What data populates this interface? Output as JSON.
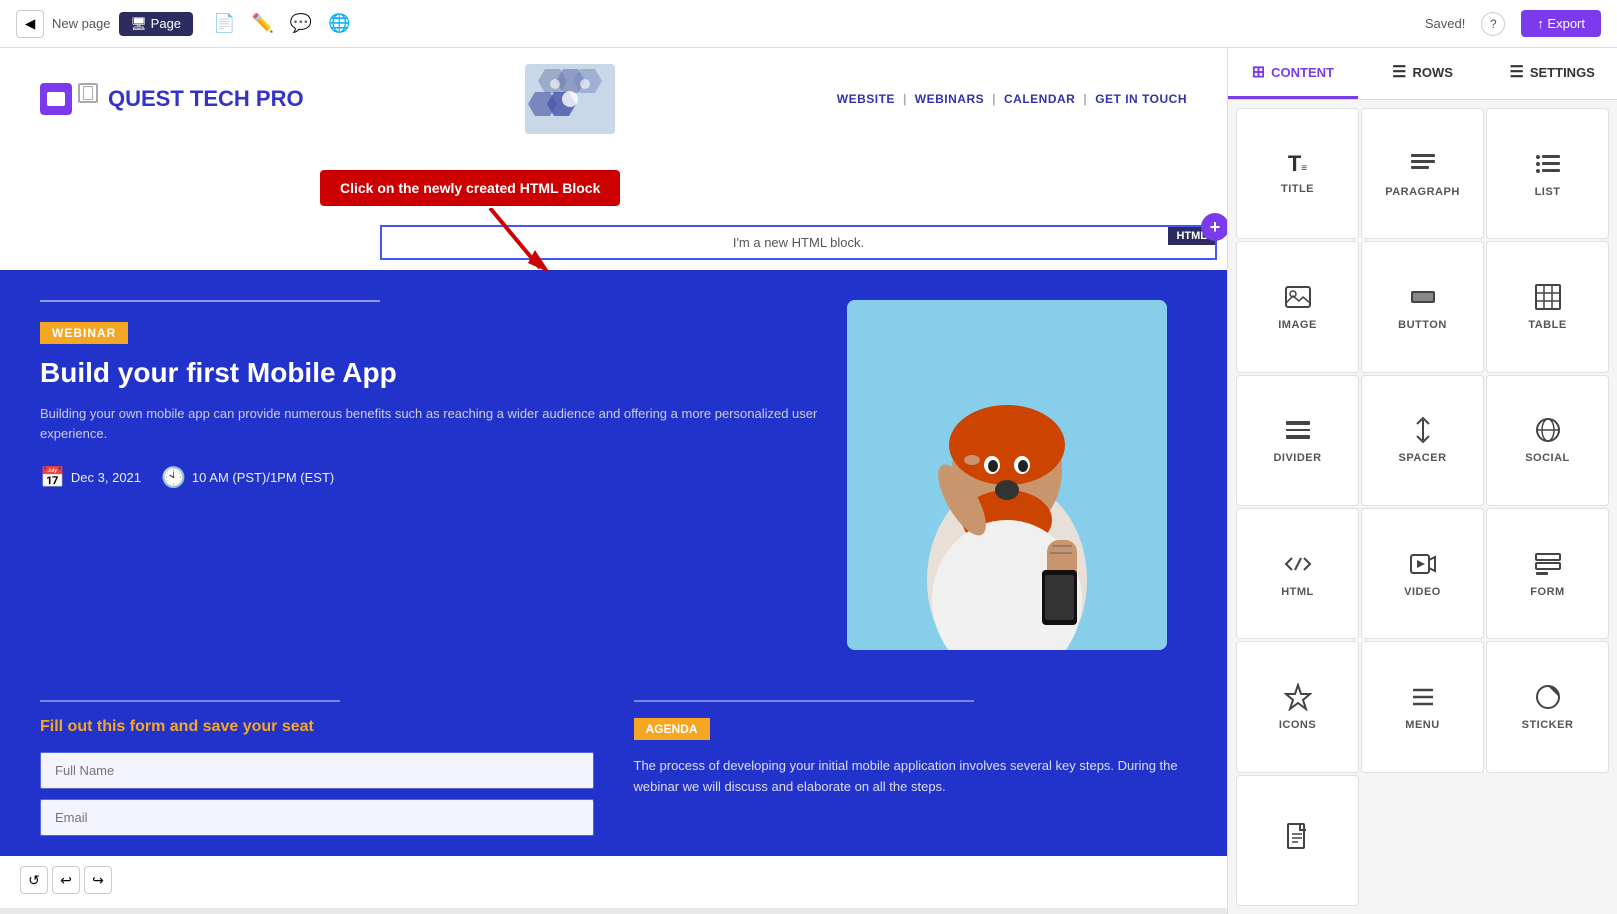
{
  "toolbar": {
    "back_label": "◀",
    "page_name": "New page",
    "page_btn_label": "🖥 Page",
    "saved_label": "Saved!",
    "help_label": "?",
    "export_label": "↑ Export",
    "icons": [
      "📄",
      "✏️",
      "💬",
      "🌐"
    ]
  },
  "right_panel": {
    "tabs": [
      {
        "label": "CONTENT",
        "icon": "⊞",
        "active": true
      },
      {
        "label": "ROWS",
        "icon": "☰",
        "active": false
      },
      {
        "label": "SETTINGS",
        "icon": "☰",
        "active": false
      }
    ],
    "blocks": [
      {
        "name": "title-block",
        "icon": "T≡",
        "label": "TITLE"
      },
      {
        "name": "paragraph-block",
        "icon": "≡≡",
        "label": "PARAGRAPH"
      },
      {
        "name": "list-block",
        "icon": "≡·",
        "label": "LIST"
      },
      {
        "name": "image-block",
        "icon": "🖼",
        "label": "IMAGE"
      },
      {
        "name": "button-block",
        "icon": "⬛",
        "label": "BUTTON"
      },
      {
        "name": "table-block",
        "icon": "⊞",
        "label": "TABLE"
      },
      {
        "name": "divider-block",
        "icon": "—",
        "label": "DIVIDER"
      },
      {
        "name": "spacer-block",
        "icon": "↕",
        "label": "SPACER"
      },
      {
        "name": "social-block",
        "icon": "⊕",
        "label": "SOCIAL"
      },
      {
        "name": "html-block",
        "icon": "</>",
        "label": "HTML"
      },
      {
        "name": "video-block",
        "icon": "▶",
        "label": "VIDEO"
      },
      {
        "name": "form-block",
        "icon": "☰",
        "label": "FORM"
      },
      {
        "name": "icons-block",
        "icon": "☆",
        "label": "ICONS"
      },
      {
        "name": "menu-block",
        "icon": "≡",
        "label": "MENU"
      },
      {
        "name": "sticker-block",
        "icon": "◑",
        "label": "STICKER"
      },
      {
        "name": "page-block",
        "icon": "📄",
        "label": ""
      }
    ]
  },
  "preview": {
    "brand": {
      "name": "QUEST TECH PRO"
    },
    "nav": {
      "items": [
        "WEBSITE",
        "WEBINARS",
        "CALENDAR",
        "GET IN TOUCH"
      ],
      "separator": "|"
    },
    "tooltip": {
      "text": "Click on the newly created HTML Block"
    },
    "html_block": {
      "text": "I'm a new HTML block.",
      "badge": "HTML"
    },
    "webinar": {
      "badge": "WEBINAR",
      "title": "Build your first Mobile App",
      "description": "Building your own mobile app can provide numerous benefits such as reaching a wider audience and offering a more personalized user experience.",
      "date_icon": "📅",
      "date": "Dec 3, 2021",
      "time_icon": "🕙",
      "time": "10 AM (PST)/1PM (EST)"
    },
    "form": {
      "title": "Fill out this form and save your seat",
      "full_name_placeholder": "Full Name",
      "email_placeholder": "Email"
    },
    "agenda": {
      "badge": "AGENDA",
      "text": "The process of developing your initial mobile application involves several key steps. During the webinar we will discuss and elaborate on all the steps."
    }
  }
}
